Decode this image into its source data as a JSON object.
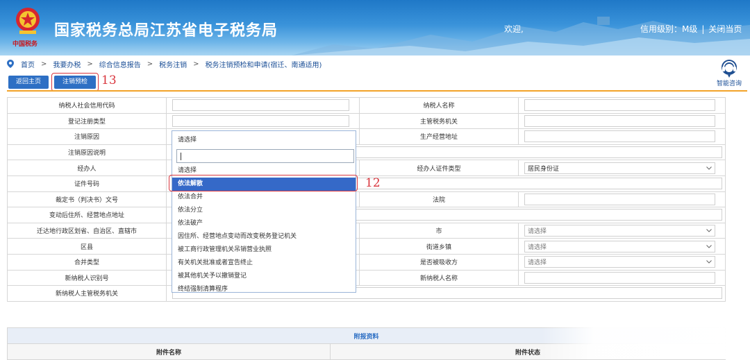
{
  "header": {
    "site_title": "国家税务总局江苏省电子税务局",
    "emblem_caption": "中国税务",
    "welcome": "欢迎,",
    "credit_level": "信用级别：M级",
    "divider": "|",
    "close_page": "关闭当页"
  },
  "breadcrumb": {
    "items": [
      "首页",
      "我要办税",
      "综合信息报告",
      "税务注销"
    ],
    "separator": ">",
    "current": "税务注销预检和申请(宿迁、南通适用)"
  },
  "toolbar": {
    "back_home": "返回主页",
    "precheck": "注销预检",
    "precheck_annotation": "13"
  },
  "assistant": {
    "label": "智能咨询",
    "icon": "headset-icon"
  },
  "form": {
    "row1": {
      "label_left": "纳税人社会信用代码",
      "label_right": "纳税人名称"
    },
    "row2": {
      "label_left": "登记注册类型",
      "label_right": "主管税务机关"
    },
    "row3": {
      "label_left": "注销原因",
      "label_right": "生产经营地址"
    },
    "row4": {
      "label_left": "注销原因说明"
    },
    "row5": {
      "label_left": "经办人",
      "label_right": "经办人证件类型",
      "right_value": "居民身份证"
    },
    "row6": {
      "label_left": "证件号码"
    },
    "row7": {
      "label_left": "裁定书（判决书）文号",
      "label_right": "法院"
    },
    "row8": {
      "label_left": "变动后住所、经营地点地址"
    },
    "row9": {
      "label_left": "迁达地行政区划省、自治区、直辖市",
      "label_right": "市",
      "right_value": "请选择"
    },
    "row10": {
      "label_left": "区县",
      "label_right": "街道乡镇",
      "right_value": "请选择"
    },
    "row11": {
      "label_left": "合并类型",
      "label_right": "是否被吸收方",
      "right_value": "请选择"
    },
    "row12": {
      "label_left": "新纳税人识别号",
      "label_right": "新纳税人名称"
    },
    "row13": {
      "label_left": "新纳税人主管税务机关"
    }
  },
  "dropdown": {
    "current": "请选择",
    "search_value": "",
    "options": [
      "请选择",
      "依法解散",
      "依法合并",
      "依法分立",
      "依法破产",
      "因住所、经营地点变动而改变税务登记机关",
      "被工商行政管理机关吊销营业执照",
      "有关机关批准或者宣告终止",
      "被其他机关予以撤销登记",
      "终结强制清算程序"
    ],
    "selected_index": 1,
    "selected_annotation": "12"
  },
  "attachments": {
    "title": "附报资料",
    "col_name": "附件名称",
    "col_status": "附件状态"
  },
  "colors": {
    "header_blue": "#1f78c7",
    "button_blue": "#2d6fc4",
    "selected_option": "#3569c8",
    "annotation_red": "#d9363e",
    "divider_orange": "#f3a329"
  }
}
